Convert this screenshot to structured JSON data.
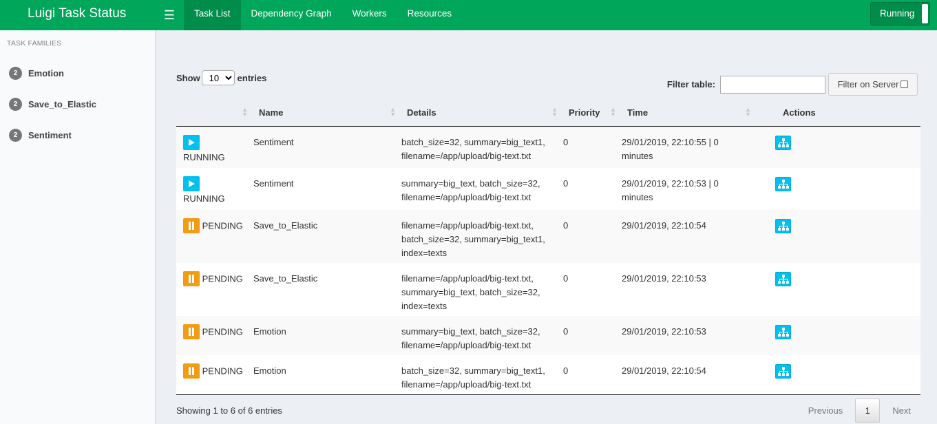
{
  "app": {
    "title": "Luigi Task Status"
  },
  "nav": {
    "menu_icon": "hamburger-icon",
    "items": [
      {
        "label": "Task List",
        "active": true
      },
      {
        "label": "Dependency Graph",
        "active": false
      },
      {
        "label": "Workers",
        "active": false
      },
      {
        "label": "Resources",
        "active": false
      }
    ],
    "status_toggle": "Running"
  },
  "sidebar": {
    "header": "TASK FAMILIES",
    "families": [
      {
        "count": "2",
        "name": "Emotion"
      },
      {
        "count": "2",
        "name": "Save_to_Elastic"
      },
      {
        "count": "2",
        "name": "Sentiment"
      }
    ]
  },
  "table_controls": {
    "show_label": "Show",
    "entries_value": "10",
    "entries_label": "entries",
    "filter_label": "Filter table:",
    "filter_value": "",
    "filter_server_label": "Filter on Server"
  },
  "table": {
    "columns": [
      "",
      "Name",
      "Details",
      "Priority",
      "Time",
      "Actions"
    ],
    "rows": [
      {
        "status": "RUNNING",
        "status_icon": "play-icon",
        "name": "Sentiment",
        "details": "batch_size=32, summary=big_text1, filename=/app/upload/big-text.txt",
        "priority": "0",
        "time": "29/01/2019, 22:10:55 | 0 minutes",
        "action_icon": "dependency-graph-icon"
      },
      {
        "status": "RUNNING",
        "status_icon": "play-icon",
        "name": "Sentiment",
        "details": "summary=big_text, batch_size=32, filename=/app/upload/big-text.txt",
        "priority": "0",
        "time": "29/01/2019, 22:10:53 | 0 minutes",
        "action_icon": "dependency-graph-icon"
      },
      {
        "status": "PENDING",
        "status_icon": "pause-icon",
        "name": "Save_to_Elastic",
        "details": "filename=/app/upload/big-text.txt, batch_size=32, summary=big_text1, index=texts",
        "priority": "0",
        "time": "29/01/2019, 22:10:54",
        "action_icon": "dependency-graph-icon"
      },
      {
        "status": "PENDING",
        "status_icon": "pause-icon",
        "name": "Save_to_Elastic",
        "details": "filename=/app/upload/big-text.txt, summary=big_text, batch_size=32, index=texts",
        "priority": "0",
        "time": "29/01/2019, 22:10:53",
        "action_icon": "dependency-graph-icon"
      },
      {
        "status": "PENDING",
        "status_icon": "pause-icon",
        "name": "Emotion",
        "details": "summary=big_text, batch_size=32, filename=/app/upload/big-text.txt",
        "priority": "0",
        "time": "29/01/2019, 22:10:53",
        "action_icon": "dependency-graph-icon"
      },
      {
        "status": "PENDING",
        "status_icon": "pause-icon",
        "name": "Emotion",
        "details": "batch_size=32, summary=big_text1, filename=/app/upload/big-text.txt",
        "priority": "0",
        "time": "29/01/2019, 22:10:54",
        "action_icon": "dependency-graph-icon"
      }
    ]
  },
  "footer": {
    "info": "Showing 1 to 6 of 6 entries",
    "previous": "Previous",
    "current_page": "1",
    "next": "Next"
  },
  "colors": {
    "navbar": "#00a65a",
    "running": "#00c0ef",
    "pending": "#f39c12",
    "badge": "#777777"
  }
}
